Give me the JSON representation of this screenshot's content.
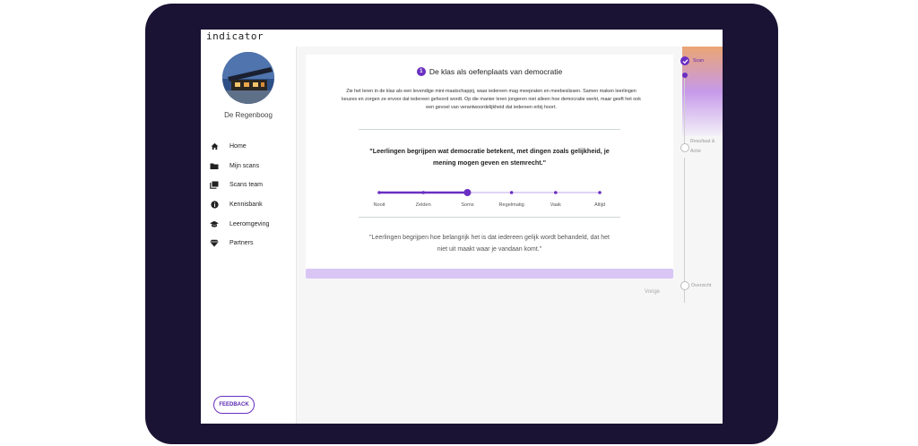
{
  "app": {
    "logo": "indicator"
  },
  "sidebar": {
    "school_name": "De Regenboog",
    "items": [
      {
        "label": "Home",
        "icon": "home-icon"
      },
      {
        "label": "Mijn scans",
        "icon": "folder-icon"
      },
      {
        "label": "Scans team",
        "icon": "library-icon"
      },
      {
        "label": "Kennisbank",
        "icon": "info-icon"
      },
      {
        "label": "Leeromgeving",
        "icon": "school-icon"
      },
      {
        "label": "Partners",
        "icon": "diamond-icon"
      }
    ],
    "feedback_label": "FEEDBACK"
  },
  "card": {
    "step_number": "1",
    "title": "De klas als oefenplaats van democratie",
    "intro": "Zie het leren in de klas als een levendige mini-maatschappij, waar iedereen mag meepraten en meebeslissen. Samen maken leerlingen keuzes en zorgen ze ervoor dat iedereen gehoord wordt. Op die manier leren jongeren niet alleen hoe democratie werkt, maar geeft het ook een gevoel van verantwoordelijkheid dat iedereen erbij hoort.",
    "statement": "\"Leerlingen begrijpen wat democratie betekent, met dingen zoals gelijkheid, je mening mogen geven en stemrecht.\"",
    "scale": {
      "options": [
        "Nooit",
        "Zelden",
        "Soms",
        "Regelmatig",
        "Vaak",
        "Altijd"
      ],
      "selected": "Soms",
      "selected_index": 2
    },
    "quote": "\"Leerlingen begrijpen hoe belangrijk het is dat iedereen gelijk wordt behandeld, dat het niet uit maakt waar je vandaan komt.\""
  },
  "navigation": {
    "previous_label": "Vorige"
  },
  "steps": [
    {
      "label": "Scan",
      "state": "done"
    },
    {
      "label": "Resultaat & Actie",
      "state": "pending"
    },
    {
      "label": "Overzicht",
      "state": "pending"
    }
  ],
  "colors": {
    "accent": "#6a2fc2",
    "tablet_frame": "#1a1333",
    "progress_bar": "#d9c6f5"
  }
}
